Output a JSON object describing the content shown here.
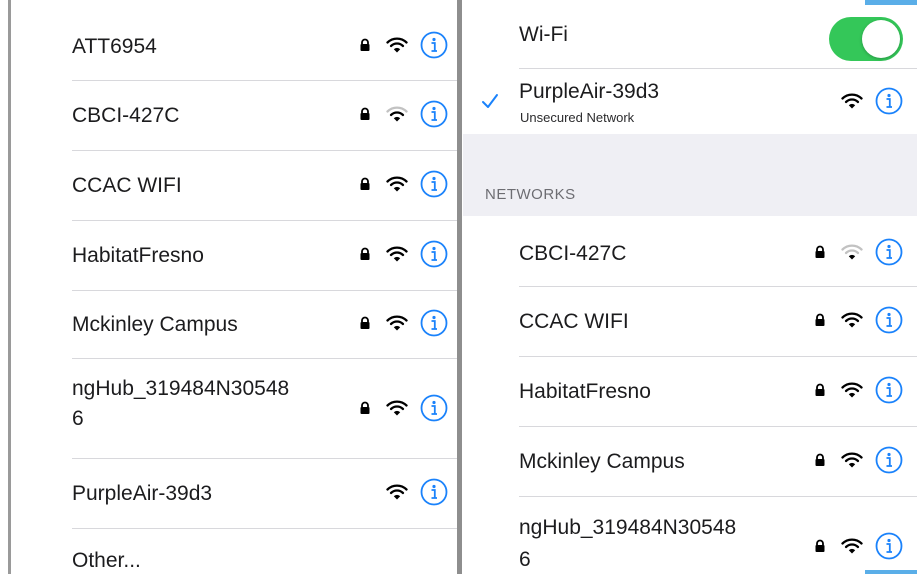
{
  "left": {
    "networks": [
      {
        "name": "ATT6954",
        "locked": true,
        "wifi": "full"
      },
      {
        "name": "CBCI-427C",
        "locked": true,
        "wifi": "weak"
      },
      {
        "name": "CCAC WIFI",
        "locked": true,
        "wifi": "full"
      },
      {
        "name": "HabitatFresno",
        "locked": true,
        "wifi": "full"
      },
      {
        "name": "Mckinley Campus",
        "locked": true,
        "wifi": "full"
      },
      {
        "name": "ngHub_319484N30548",
        "name_line2": "6",
        "locked": true,
        "wifi": "full"
      },
      {
        "name": "PurpleAir-39d3",
        "locked": false,
        "wifi": "full"
      }
    ],
    "other_label": "Other..."
  },
  "right": {
    "wifi_label": "Wi-Fi",
    "wifi_enabled": true,
    "connected": {
      "name": "PurpleAir-39d3",
      "subtitle": "Unsecured Network"
    },
    "section_header": "NETWORKS",
    "networks": [
      {
        "name": "CBCI-427C",
        "locked": true,
        "wifi": "weak"
      },
      {
        "name": "CCAC WIFI",
        "locked": true,
        "wifi": "full"
      },
      {
        "name": "HabitatFresno",
        "locked": true,
        "wifi": "full"
      },
      {
        "name": "Mckinley Campus",
        "locked": true,
        "wifi": "full"
      },
      {
        "name": "ngHub_319484N30548",
        "name_line2": "6",
        "locked": true,
        "wifi": "full"
      }
    ]
  },
  "colors": {
    "accent": "#1a82fb",
    "toggle_on": "#34c759",
    "separator": "#d8d8dc",
    "section_bg": "#efeff4"
  }
}
